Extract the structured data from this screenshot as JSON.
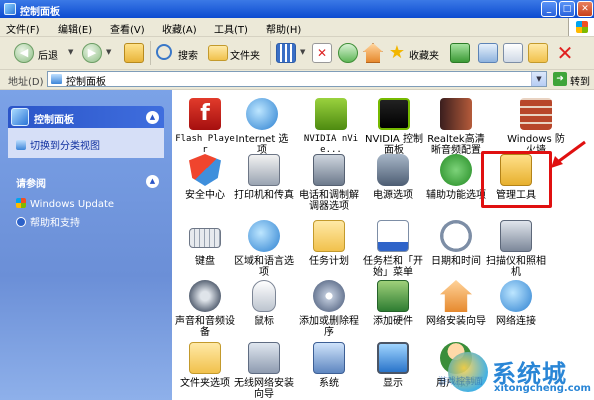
{
  "window": {
    "title": "控制面板"
  },
  "menu": [
    "文件(F)",
    "编辑(E)",
    "查看(V)",
    "收藏(A)",
    "工具(T)",
    "帮助(H)"
  ],
  "toolbar": {
    "back_label": "后退",
    "search_label": "搜索",
    "folders_label": "文件夹",
    "favorites_label": "收藏夹"
  },
  "address": {
    "label": "地址(D)",
    "value": "控制面板",
    "go_label": "转到"
  },
  "left_pane": {
    "panel1": {
      "title": "控制面板",
      "links": [
        "切换到分类视图"
      ]
    },
    "panel2": {
      "title": "请参阅",
      "links": [
        "Windows Update",
        "帮助和支持"
      ]
    }
  },
  "items": [
    {
      "label": "Flash Player",
      "icon": "flash-player-icon"
    },
    {
      "label": "Internet 选项",
      "icon": "internet-options-icon"
    },
    {
      "label": "NVIDIA nVie...",
      "icon": "nvidia-nview-icon"
    },
    {
      "label": "NVIDIA 控制面板",
      "icon": "nvidia-control-panel-icon"
    },
    {
      "label": "Realtek高清晰音频配置",
      "icon": "realtek-audio-icon"
    },
    {
      "label": "Windows 防火墙",
      "icon": "windows-firewall-icon"
    },
    {
      "label": "安全中心",
      "icon": "security-center-icon"
    },
    {
      "label": "打印机和传真",
      "icon": "printers-fax-icon"
    },
    {
      "label": "电话和调制解调器选项",
      "icon": "phone-modem-icon"
    },
    {
      "label": "电源选项",
      "icon": "power-options-icon"
    },
    {
      "label": "辅助功能选项",
      "icon": "accessibility-icon"
    },
    {
      "label": "管理工具",
      "icon": "admin-tools-icon"
    },
    {
      "label": "键盘",
      "icon": "keyboard-icon"
    },
    {
      "label": "区域和语言选项",
      "icon": "region-language-icon"
    },
    {
      "label": "任务计划",
      "icon": "scheduled-tasks-icon"
    },
    {
      "label": "任务栏和「开始」菜单",
      "icon": "taskbar-start-menu-icon"
    },
    {
      "label": "日期和时间",
      "icon": "date-time-icon"
    },
    {
      "label": "扫描仪和照相机",
      "icon": "scanner-camera-icon"
    },
    {
      "label": "声音和音频设备",
      "icon": "sound-audio-icon"
    },
    {
      "label": "鼠标",
      "icon": "mouse-icon"
    },
    {
      "label": "添加或删除程序",
      "icon": "add-remove-programs-icon"
    },
    {
      "label": "添加硬件",
      "icon": "add-hardware-icon"
    },
    {
      "label": "网络安装向导",
      "icon": "network-setup-wizard-icon"
    },
    {
      "label": "网络连接",
      "icon": "network-connections-icon"
    },
    {
      "label": "文件夹选项",
      "icon": "folder-options-icon"
    },
    {
      "label": "无线网络安装向导",
      "icon": "wireless-setup-wizard-icon"
    },
    {
      "label": "系统",
      "icon": "system-icon"
    },
    {
      "label": "显示",
      "icon": "display-icon"
    },
    {
      "label": "用户帐户",
      "icon": "user-accounts-icon"
    }
  ],
  "watermark": {
    "name": "系统城",
    "url": "xitongcheng.com",
    "overlay": "游戏控制面"
  },
  "colors": {
    "highlight": "#e01010",
    "titlebar": "#0c4bd0",
    "left_pane": "#6b8fd7"
  }
}
